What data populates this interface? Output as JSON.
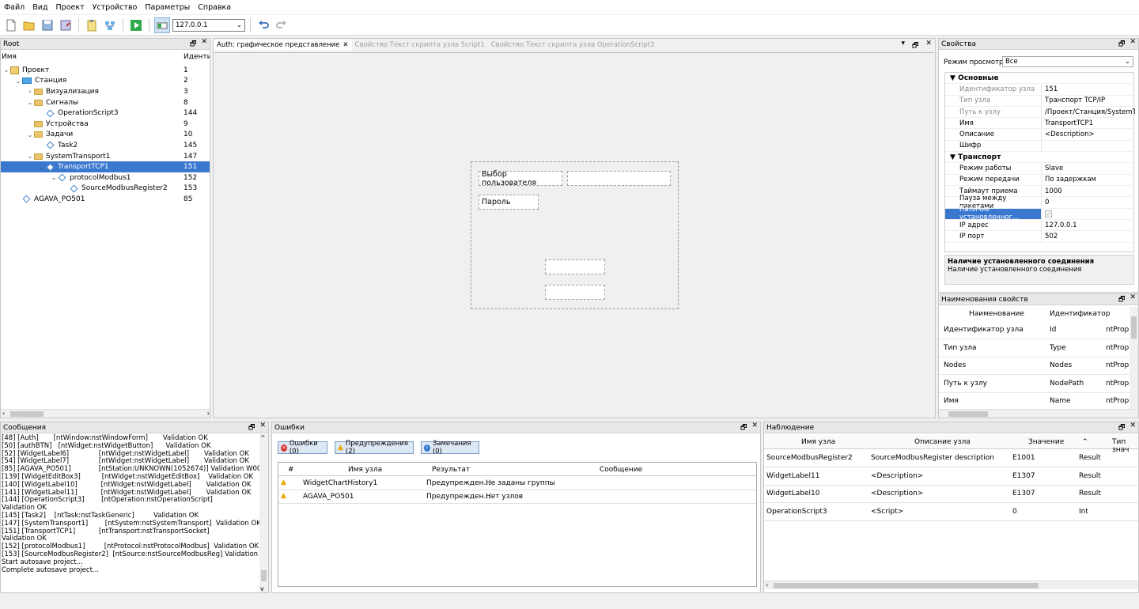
{
  "menu": [
    "Файл",
    "Вид",
    "Проект",
    "Устройство",
    "Параметры",
    "Справка"
  ],
  "toolbar": {
    "address": "127.0.0.1"
  },
  "tree": {
    "title": "Root",
    "col_name": "Имя",
    "col_id": "Идентис",
    "rows": [
      {
        "label": "Проект",
        "id": "1",
        "indent": 0,
        "icon": "project",
        "arrow": "v"
      },
      {
        "label": "Станция",
        "id": "2",
        "indent": 1,
        "icon": "pc",
        "arrow": "v"
      },
      {
        "label": "Визуализация",
        "id": "3",
        "indent": 2,
        "icon": "folder",
        "arrow": ">"
      },
      {
        "label": "Сигналы",
        "id": "8",
        "indent": 2,
        "icon": "folder",
        "arrow": "v"
      },
      {
        "label": "OperationScript3",
        "id": "144",
        "indent": 3,
        "icon": "diamond",
        "arrow": ""
      },
      {
        "label": "Устройства",
        "id": "9",
        "indent": 2,
        "icon": "folder",
        "arrow": ""
      },
      {
        "label": "Задачи",
        "id": "10",
        "indent": 2,
        "icon": "folder",
        "arrow": "v"
      },
      {
        "label": "Task2",
        "id": "145",
        "indent": 3,
        "icon": "diamond",
        "arrow": ""
      },
      {
        "label": "SystemTransport1",
        "id": "147",
        "indent": 2,
        "icon": "folder",
        "arrow": "v"
      },
      {
        "label": "TransportTCP1",
        "id": "151",
        "indent": 3,
        "icon": "diamond",
        "arrow": "v",
        "selected": true
      },
      {
        "label": "protocolModbus1",
        "id": "152",
        "indent": 4,
        "icon": "diamond",
        "arrow": "v"
      },
      {
        "label": "SourceModbusRegister2",
        "id": "153",
        "indent": 5,
        "icon": "diamond",
        "arrow": ""
      },
      {
        "label": "AGAVA_PO501",
        "id": "85",
        "indent": 1,
        "icon": "diamond",
        "arrow": ""
      }
    ]
  },
  "editor": {
    "tabs": [
      "Auth: графическое представление",
      "Свойство Текст скрипта узла Script1",
      "Свойство Текст скрипта узла OperationScript3"
    ],
    "label_user": "Выбор пользователя",
    "label_password": "Пароль"
  },
  "properties": {
    "title": "Свойства",
    "view_mode_label": "Режим просмотра:",
    "view_mode_value": "Все",
    "cat_main": "Основные",
    "cat_transport": "Транспорт",
    "main_rows": [
      {
        "name": "Идентификатор узла",
        "value": "151",
        "disabled": true
      },
      {
        "name": "Тип узла",
        "value": "Транспорт TCP/IP",
        "disabled": true
      },
      {
        "name": "Путь к узлу",
        "value": "/Проект/Станция/SystemTra...",
        "disabled": true
      },
      {
        "name": "Имя",
        "value": "TransportTCP1",
        "disabled": false
      },
      {
        "name": "Описание",
        "value": "<Description>",
        "disabled": false
      },
      {
        "name": "Шифр",
        "value": "",
        "disabled": false
      }
    ],
    "transport_rows": [
      {
        "name": "Режим работы",
        "value": "Slave"
      },
      {
        "name": "Режим передачи",
        "value": "По задержкам"
      },
      {
        "name": "Таймаут приема",
        "value": "1000"
      },
      {
        "name": "Пауза между пакетами",
        "value": "0"
      },
      {
        "name": "Наличие установленног...",
        "value": "",
        "selected": true,
        "checkbox": true
      },
      {
        "name": "IP адрес",
        "value": "127.0.0.1"
      },
      {
        "name": "IP порт",
        "value": "502"
      }
    ],
    "desc_title": "Наличие установленного соединения",
    "desc_text": "Наличие установленного соединения"
  },
  "prop_names": {
    "title": "Наименования свойств",
    "headers": [
      "Наименование",
      "Идентификатор"
    ],
    "rows": [
      [
        "Идентификатор узла",
        "Id",
        "ntProp"
      ],
      [
        "Тип узла",
        "Type",
        "ntProp"
      ],
      [
        "Nodes",
        "Nodes",
        "ntProp"
      ],
      [
        "Путь к узлу",
        "NodePath",
        "ntProp"
      ],
      [
        "Имя",
        "Name",
        "ntProp"
      ]
    ]
  },
  "messages": {
    "title": "Сообщения",
    "lines": [
      "[48] [Auth]       [ntWindow:nstWindowForm]       Validation OK",
      "[50] [authBTN]   [ntWidget:nstWidgetButton]      Validation OK",
      "[52] [WidgetLabel6]              [ntWidget:nstWidgetLabel]       Validation OK",
      "[54] [WidgetLabel7]              [ntWidget:nstWidgetLabel]       Validation OK",
      "[85] [AGAVA_PO501]             [ntStation:UNKNOWN(1052674)] Validation W0000",
      "[139] [WidgetEditBox3]          [ntWidget:nstWidgetEditBox]    Validation OK",
      "[140] [WidgetLabel10]           [ntWidget:nstWidgetLabel]       Validation OK",
      "[141] [WidgetLabel11]           [ntWidget:nstWidgetLabel]       Validation OK",
      "[144] [OperationScript3]        [ntOperation:nstOperationScript]",
      "Validation OK",
      "[145] [Task2]    [ntTask:nstTaskGeneric]         Validation OK",
      "[147] [SystemTransport1]        [ntSystem:nstSystemTransport]  Validation OK",
      "[151] [TransportTCP1]           [ntTransport:nstTransportSocket]",
      "Validation OK",
      "[152] [protocolModbus1]         [ntProtocol:nstProtocolModbus]  Validation OK",
      "[153] [SourceModbusRegister2]  [ntSource:nstSourceModbusReg] Validation OK",
      "Start autosave project...",
      "Complete autosave project..."
    ]
  },
  "errors": {
    "title": "Ошибки",
    "btn_errors": "Ошибки (0)",
    "btn_warnings": "Предупреждения (2)",
    "btn_notes": "Замечания (0)",
    "headers": [
      "#",
      "Имя узла",
      "Результат",
      "Сообщение"
    ],
    "rows": [
      [
        "WidgetChartHistory1",
        "Предупрежден...",
        "Не заданы группы"
      ],
      [
        "AGAVA_PO501",
        "Предупрежден...",
        "Нет узлов"
      ]
    ]
  },
  "watch": {
    "title": "Наблюдение",
    "headers": [
      "Имя узла",
      "Описание узла",
      "Значение",
      "Тип знач"
    ],
    "rows": [
      [
        "SourceModbusRegister2",
        "SourceModbusRegister description",
        "E1001",
        "Result"
      ],
      [
        "WidgetLabel11",
        "<Description>",
        "E1307",
        "Result"
      ],
      [
        "WidgetLabel10",
        "<Description>",
        "E1307",
        "Result"
      ],
      [
        "OperationScript3",
        "<Script>",
        "0",
        "Int"
      ]
    ]
  },
  "panel_buttons": {
    "float": "🗗",
    "close": "✕"
  }
}
